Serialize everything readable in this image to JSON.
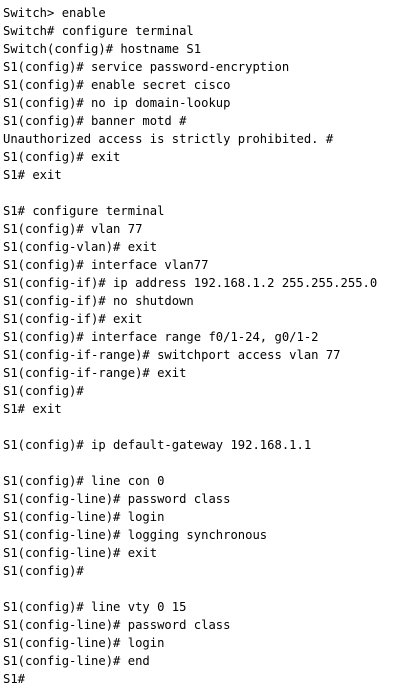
{
  "terminal": {
    "lines": [
      "Switch> enable",
      "Switch# configure terminal",
      "Switch(config)# hostname S1",
      "S1(config)# service password-encryption",
      "S1(config)# enable secret cisco",
      "S1(config)# no ip domain-lookup",
      "S1(config)# banner motd #",
      "Unauthorized access is strictly prohibited. #",
      "S1(config)# exit",
      "S1# exit",
      "",
      "S1# configure terminal",
      "S1(config)# vlan 77",
      "S1(config-vlan)# exit",
      "S1(config)# interface vlan77",
      "S1(config-if)# ip address 192.168.1.2 255.255.255.0",
      "S1(config-if)# no shutdown",
      "S1(config-if)# exit",
      "S1(config)# interface range f0/1-24, g0/1-2",
      "S1(config-if-range)# switchport access vlan 77",
      "S1(config-if-range)# exit",
      "S1(config)#",
      "S1# exit",
      "",
      "S1(config)# ip default-gateway 192.168.1.1",
      "",
      "S1(config)# line con 0",
      "S1(config-line)# password class",
      "S1(config-line)# login",
      "S1(config-line)# logging synchronous",
      "S1(config-line)# exit",
      "S1(config)#",
      "",
      "S1(config)# line vty 0 15",
      "S1(config-line)# password class",
      "S1(config-line)# login",
      "S1(config-line)# end",
      "S1#"
    ]
  }
}
